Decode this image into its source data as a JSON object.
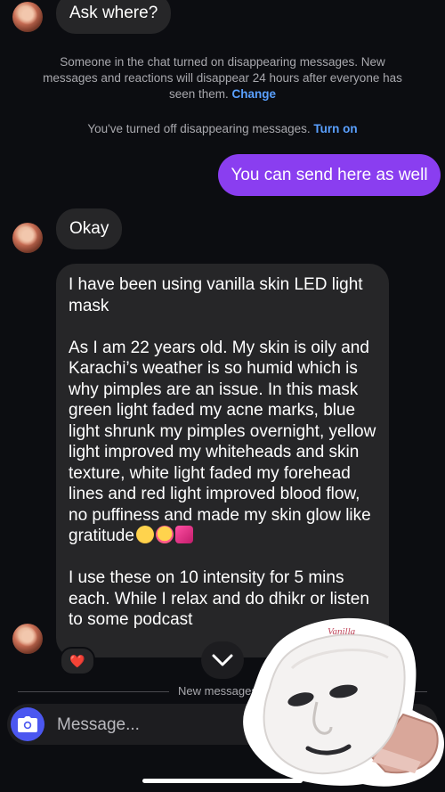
{
  "messages": {
    "top_in": "Ask where?",
    "out_1": "You can send here as well",
    "in_okay": "Okay",
    "long_p1": "I have been using vanilla skin LED light mask",
    "long_p2": "As I am 22 years old. My skin is oily and Karachi’s weather is so humid which is why pimples are an issue. In this mask green light faded my acne marks, blue light shrunk my pimples overnight, yellow light improved my whiteheads and skin texture, white light faded my forehead lines and red light improved blood flow, no puffiness and made my skin glow like gratitude",
    "long_p3": "I use these on 10 intensity for 5 mins each. While I relax and do dhikr or listen to some podcast"
  },
  "notices": {
    "disappearing_on": "Someone in the chat turned on disappearing messages. New messages and reactions will disappear 24 hours after everyone has seen them.",
    "change_link": "Change",
    "disappearing_off": "You've turned off disappearing messages.",
    "turn_on_link": "Turn on"
  },
  "reaction_emoji": "❤️",
  "divider": {
    "label": "New messages"
  },
  "composer": {
    "placeholder": "Message..."
  },
  "sticker": {
    "brand": "Vanilla"
  },
  "colors": {
    "background": "#0c0d11",
    "incoming_bubble": "#262628",
    "outgoing_bubble": "#8a3ef0",
    "link": "#5aa0ff",
    "camera_button": "#4b57f0"
  },
  "icons": [
    "camera-icon",
    "chevron-down-icon",
    "heart-reaction-icon"
  ]
}
